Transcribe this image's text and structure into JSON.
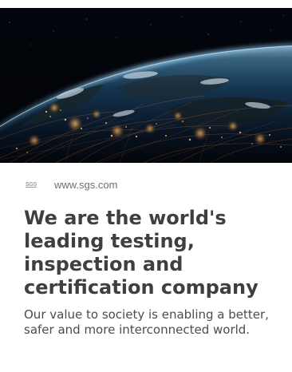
{
  "source": {
    "favicon_text": "SGS",
    "domain": "www.sgs.com"
  },
  "article": {
    "headline": "We are the world's leading testing, inspection and certification company",
    "description": "Our value to society is enabling a better, safer and more interconnected world."
  },
  "colors": {
    "headline": "#3f3f3f",
    "description": "#4c4c4c",
    "domain": "#6f6f6f",
    "hero_background": "#02050b"
  },
  "icons": {
    "favicon": "sgs-logo-icon"
  }
}
